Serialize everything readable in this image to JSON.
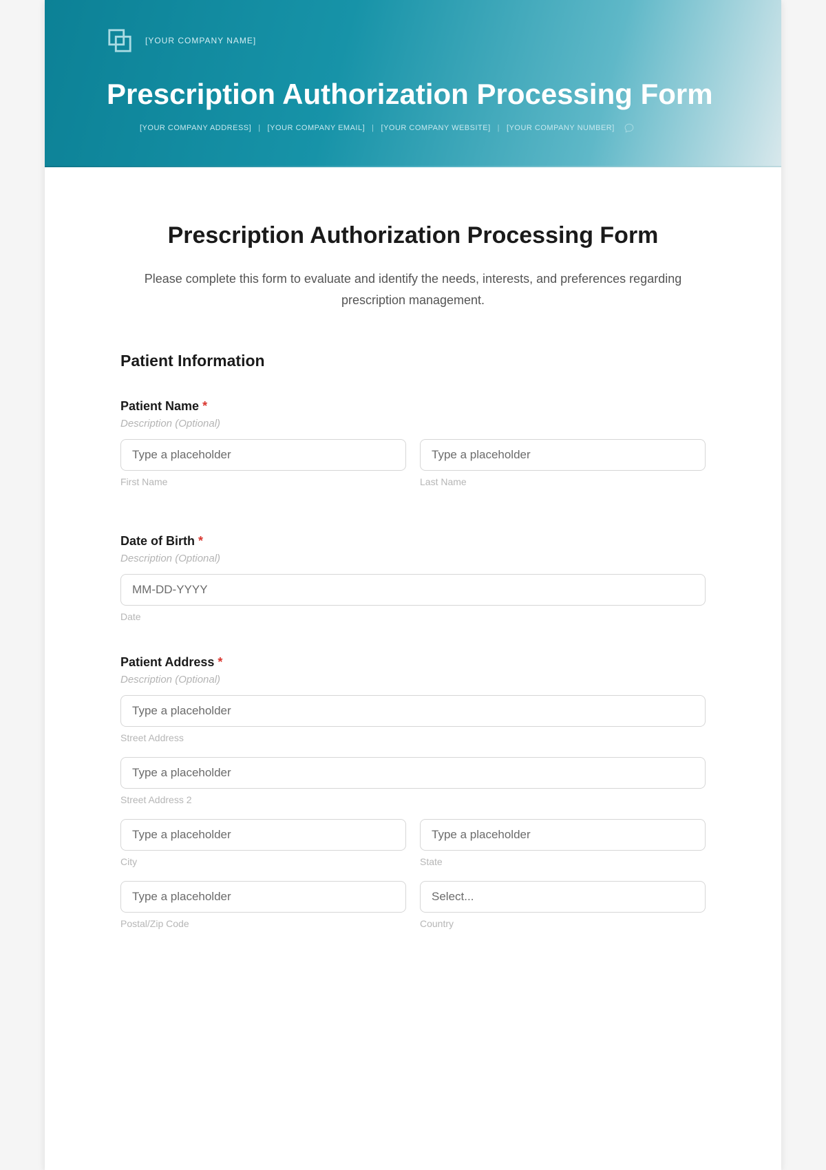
{
  "header": {
    "brand": "[YOUR COMPANY NAME]",
    "title": "Prescription Authorization Processing Form",
    "meta": {
      "address": "[YOUR COMPANY ADDRESS]",
      "email": "[YOUR COMPANY EMAIL]",
      "website": "[YOUR COMPANY WEBSITE]",
      "number": "[YOUR COMPANY NUMBER]"
    }
  },
  "form": {
    "title": "Prescription Authorization Processing Form",
    "intro": "Please complete this form to evaluate and identify the needs, interests, and preferences regarding prescription management.",
    "section1_title": "Patient Information",
    "desc_optional": "Description (Optional)",
    "placeholder": "Type a placeholder",
    "patient_name": {
      "label": "Patient Name",
      "first_sub": "First Name",
      "last_sub": "Last Name"
    },
    "dob": {
      "label": "Date of Birth",
      "placeholder": "MM-DD-YYYY",
      "sub": "Date"
    },
    "address": {
      "label": "Patient Address",
      "street_sub": "Street Address",
      "street2_sub": "Street Address 2",
      "city_sub": "City",
      "state_sub": "State",
      "postal_sub": "Postal/Zip Code",
      "country_sub": "Country",
      "country_placeholder": "Select..."
    }
  }
}
